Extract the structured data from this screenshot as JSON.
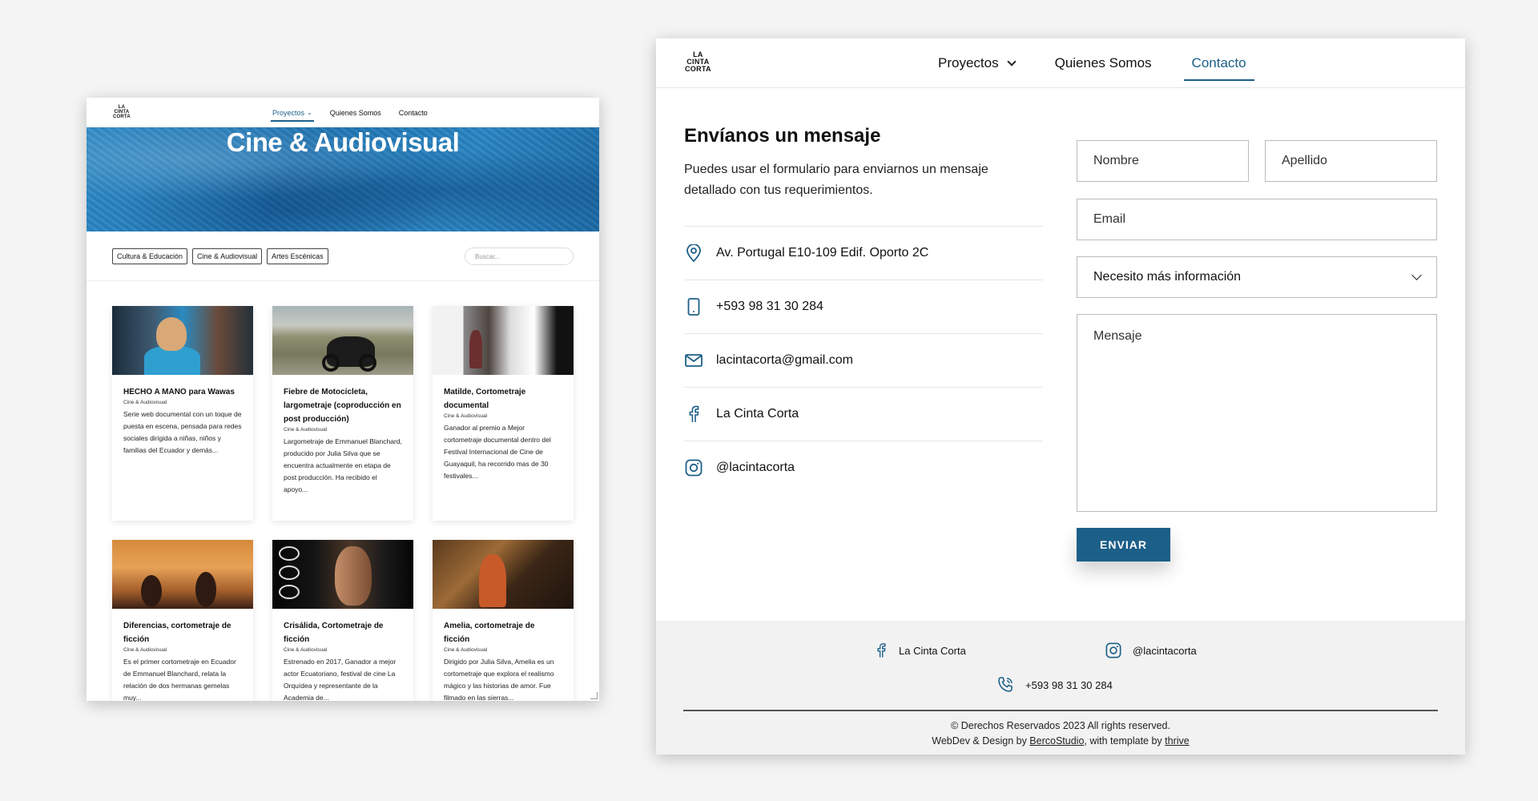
{
  "left": {
    "logo": [
      "LA",
      "CINTA",
      "CORTA"
    ],
    "nav": [
      {
        "label": "Proyectos",
        "active": true,
        "dropdown": true
      },
      {
        "label": "Quienes Somos",
        "active": false
      },
      {
        "label": "Contacto",
        "active": false
      }
    ],
    "hero_title": "Cine & Audiovisual",
    "filters": [
      "Cultura & Educación",
      "Cine & Audiovisual",
      "Artes Escénicas"
    ],
    "search_placeholder": "Buscar...",
    "cards": [
      {
        "title": "HECHO A MANO para Wawas",
        "category": "Cine & Audiovisual",
        "desc": "Serie web documental con un toque de puesta en escena, pensada para redes sociales dirigida a niñas, niños y familias del Ecuador y demás..."
      },
      {
        "title": "Fiebre de Motocicleta, largometraje (coproducción en post producción)",
        "category": "Cine & Audiovisual",
        "desc": "Largometraje de Emmanuel Blanchard, producido por Julia Silva que se encuentra actualmente en etapa de post producción. Ha recibido el apoyo..."
      },
      {
        "title": "Matilde, Cortometraje documental",
        "category": "Cine & Audiovisual",
        "desc": "Ganador al premio a Mejor cortometraje documental dentro del Festival Internacional de Cine de Guayaquil, ha recorrido mas de 30 festivales..."
      },
      {
        "title": "Diferencias, cortometraje de ficción",
        "category": "Cine & Audiovisual",
        "desc": "Es el primer cortometraje en Ecuador de Emmanuel Blanchard, relata la relación de dos hermanas gemelas muy..."
      },
      {
        "title": "Crisálida, Cortometraje de ficción",
        "category": "Cine & Audiovisual",
        "desc": "Estrenado en 2017, Ganador a mejor actor Ecuatoriano, festival de cine La Orquídea y representante de la Academia de..."
      },
      {
        "title": "Amelia, cortometraje de ficción",
        "category": "Cine & Audiovisual",
        "desc": "Dirigido por Julia Silva, Amelia es un cortometraje que explora el realismo mágico y las historias de amor. Fue filmado en las sierras..."
      }
    ]
  },
  "right": {
    "logo": [
      "LA",
      "CINTA",
      "CORTA"
    ],
    "nav": [
      {
        "label": "Proyectos",
        "active": false,
        "dropdown": true
      },
      {
        "label": "Quienes Somos",
        "active": false
      },
      {
        "label": "Contacto",
        "active": true
      }
    ],
    "heading": "Envíanos un mensaje",
    "intro": "Puedes usar el formulario para enviarnos un mensaje detallado con tus requerimientos.",
    "info": [
      {
        "icon": "location-pin-icon",
        "text": "Av. Portugal E10-109 Edif. Oporto 2C"
      },
      {
        "icon": "phone-icon",
        "text": "+593 98 31 30 284"
      },
      {
        "icon": "mail-icon",
        "text": "lacintacorta@gmail.com"
      },
      {
        "icon": "facebook-icon",
        "text": "La Cinta Corta"
      },
      {
        "icon": "instagram-icon",
        "text": "@lacintacorta"
      }
    ],
    "form": {
      "first_name_placeholder": "Nombre",
      "last_name_placeholder": "Apellido",
      "email_placeholder": "Email",
      "select_value": "Necesito más información",
      "message_placeholder": "Mensaje",
      "submit": "ENVIAR"
    },
    "footer": {
      "facebook": "La Cinta Corta",
      "instagram": "@lacintacorta",
      "phone": "+593 98 31 30 284",
      "copyright": "© Derechos Reservados 2023 All rights reserved.",
      "credit_prefix": "WebDev & Design by ",
      "credit_studio": "BercoStudio",
      "credit_mid": ", with template by ",
      "credit_template": "thrive"
    }
  },
  "colors": {
    "accent": "#1c5f88",
    "background": "#f4f4f4",
    "footer": "#f2f2f2"
  }
}
